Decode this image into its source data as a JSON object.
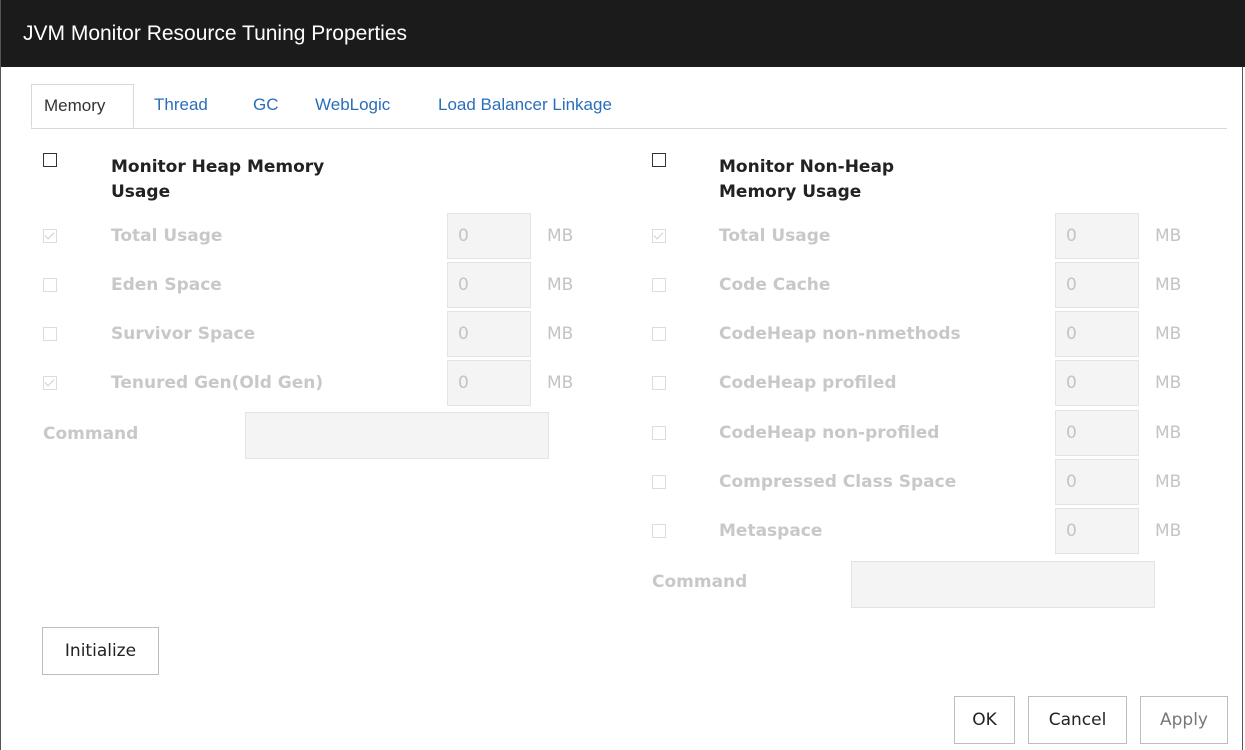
{
  "window": {
    "title": "JVM Monitor Resource Tuning Properties"
  },
  "tabs": [
    {
      "label": "Memory",
      "active": true
    },
    {
      "label": "Thread"
    },
    {
      "label": "GC"
    },
    {
      "label": "WebLogic"
    },
    {
      "label": "Load Balancer Linkage"
    }
  ],
  "heap": {
    "heading_line1": "Monitor Heap Memory",
    "heading_line2": "Usage",
    "checked": false,
    "items": [
      {
        "label": "Total Usage",
        "value": "0",
        "unit": "MB",
        "checked": true
      },
      {
        "label": "Eden Space",
        "value": "0",
        "unit": "MB",
        "checked": false
      },
      {
        "label": "Survivor Space",
        "value": "0",
        "unit": "MB",
        "checked": false
      },
      {
        "label": "Tenured Gen(Old Gen)",
        "value": "0",
        "unit": "MB",
        "checked": true
      }
    ],
    "command_label": "Command",
    "command_value": ""
  },
  "nonheap": {
    "heading_line1": "Monitor Non-Heap",
    "heading_line2": "Memory Usage",
    "checked": false,
    "items": [
      {
        "label": "Total Usage",
        "value": "0",
        "unit": "MB",
        "checked": true
      },
      {
        "label": "Code Cache",
        "value": "0",
        "unit": "MB",
        "checked": false
      },
      {
        "label": "CodeHeap non-nmethods",
        "value": "0",
        "unit": "MB",
        "checked": false
      },
      {
        "label": "CodeHeap profiled",
        "value": "0",
        "unit": "MB",
        "checked": false
      },
      {
        "label": "CodeHeap non-profiled",
        "value": "0",
        "unit": "MB",
        "checked": false
      },
      {
        "label": "Compressed Class Space",
        "value": "0",
        "unit": "MB",
        "checked": false
      },
      {
        "label": "Metaspace",
        "value": "0",
        "unit": "MB",
        "checked": false
      }
    ],
    "command_label": "Command",
    "command_value": ""
  },
  "buttons": {
    "initialize": "Initialize",
    "ok": "OK",
    "cancel": "Cancel",
    "apply": "Apply"
  }
}
